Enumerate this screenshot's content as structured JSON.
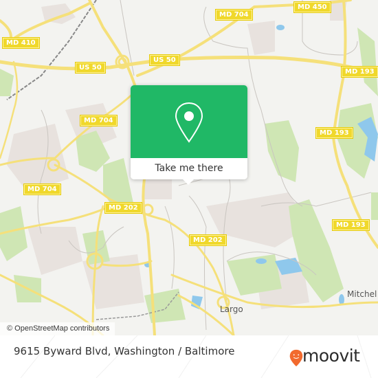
{
  "map": {
    "road_labels": [
      {
        "id": "md410",
        "text": "MD 410"
      },
      {
        "id": "md704-top",
        "text": "MD 704"
      },
      {
        "id": "md450",
        "text": "MD 450"
      },
      {
        "id": "us50-left",
        "text": "US 50"
      },
      {
        "id": "us50-right",
        "text": "US 50"
      },
      {
        "id": "md193-top",
        "text": "MD 193"
      },
      {
        "id": "md704-mid",
        "text": "MD 704"
      },
      {
        "id": "md193-mid",
        "text": "MD 193"
      },
      {
        "id": "md704-left",
        "text": "MD 704"
      },
      {
        "id": "md202-left",
        "text": "MD 202"
      },
      {
        "id": "md193-right",
        "text": "MD 193"
      },
      {
        "id": "md202-center",
        "text": "MD 202"
      }
    ],
    "place_labels": [
      {
        "id": "largo",
        "text": "Largo"
      },
      {
        "id": "mitchellville",
        "text": "Mitchel"
      }
    ],
    "attribution": "© OpenStreetMap contributors",
    "colors": {
      "background": "#f3f3f0",
      "road": "#f5e07a",
      "road_shield": "#f0d82b",
      "park": "#cfe6b4",
      "water": "#8fc8ec",
      "urban": "#e8e2de"
    }
  },
  "popup": {
    "button_label": "Take me there",
    "icon": "map-pin-icon",
    "accent": "#20b866"
  },
  "footer": {
    "address": "9615 Byward Blvd, Washington / Baltimore",
    "brand": "moovit",
    "brand_color": "#f26a2e"
  }
}
